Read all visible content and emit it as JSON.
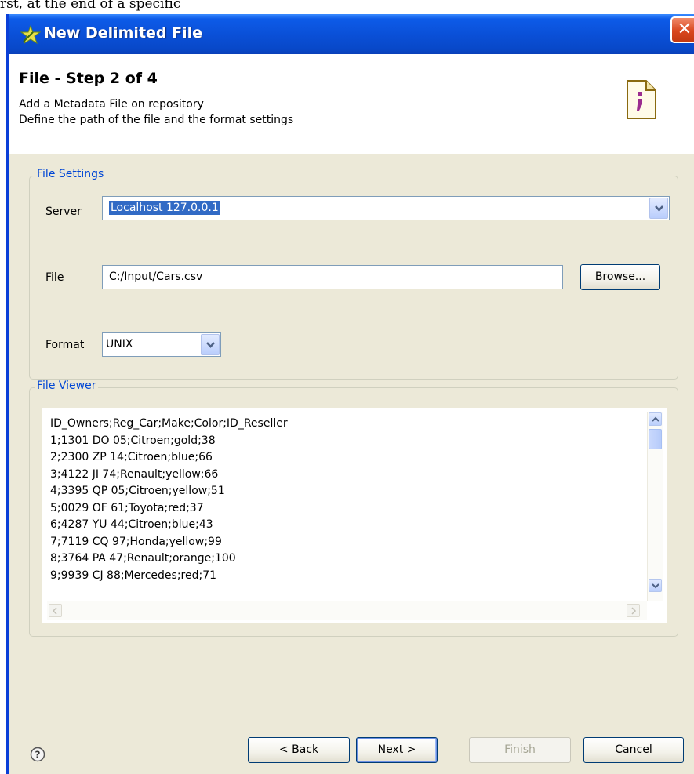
{
  "window": {
    "title": "New Delimited File",
    "close_glyph": "✕"
  },
  "header": {
    "step_title": "File - Step 2 of 4",
    "description_line1": "Add a Metadata File on repository",
    "description_line2": "Define the path of the file and the format settings"
  },
  "file_settings": {
    "group_label": "File Settings",
    "server_label": "Server",
    "server_value": "Localhost 127.0.0.1",
    "file_label": "File",
    "file_value": "C:/Input/Cars.csv",
    "browse_label": "Browse...",
    "format_label": "Format",
    "format_value": "UNIX"
  },
  "file_viewer": {
    "group_label": "File Viewer",
    "lines": [
      "ID_Owners;Reg_Car;Make;Color;ID_Reseller",
      "1;1301 DO 05;Citroen;gold;38",
      "2;2300 ZP 14;Citroen;blue;66",
      "3;4122 JI 74;Renault;yellow;66",
      "4;3395 QP 05;Citroen;yellow;51",
      "5;0029 OF 61;Toyota;red;37",
      "6;4287 YU 44;Citroen;blue;43",
      "7;7119 CQ 97;Honda;yellow;99",
      "8;3764 PA 47;Renault;orange;100",
      "9;9939 CJ 88;Mercedes;red;71"
    ]
  },
  "footer": {
    "back_label": "< Back",
    "next_label": "Next >",
    "finish_label": "Finish",
    "cancel_label": "Cancel"
  },
  "icons": {
    "title_icon": "wizard-star-icon",
    "header_icon": "delimited-file-icon",
    "help_icon": "help-icon"
  },
  "colors": {
    "titlebar": "#0a4fd6",
    "group_label": "#0046d5",
    "close_button": "#d9471e",
    "dialog_background": "#ece9d8"
  }
}
